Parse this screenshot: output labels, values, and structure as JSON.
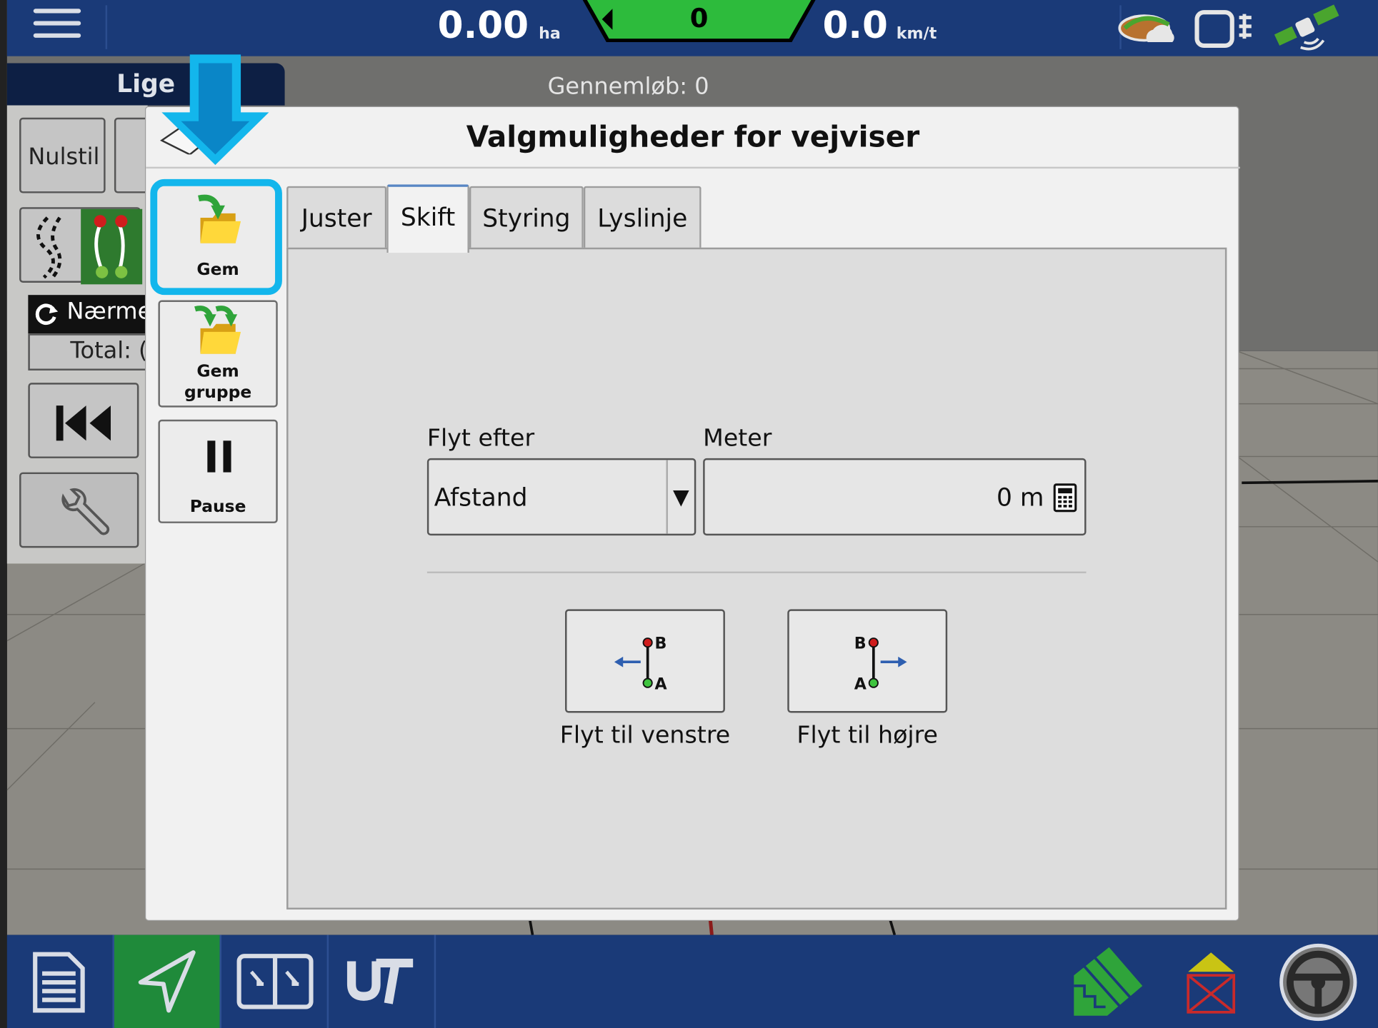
{
  "topbar": {
    "area_value": "0.00",
    "area_unit": "ha",
    "counter_value": "0",
    "speed_value": "0.0",
    "speed_unit": "km/t"
  },
  "guide_tab": {
    "label": "Lige"
  },
  "passes_label": "Gennemløb: 0",
  "background_panel": {
    "reset_label": "Nulstil",
    "nearest_label": "Nærme",
    "total_label": "Total: ("
  },
  "dialog": {
    "title": "Valgmuligheder for vejviser",
    "side_buttons": [
      {
        "label": "Gem"
      },
      {
        "label_line1": "Gem",
        "label_line2": "gruppe"
      },
      {
        "label": "Pause"
      }
    ],
    "tabs": [
      {
        "label": "Juster"
      },
      {
        "label": "Skift",
        "active": true
      },
      {
        "label": "Styring"
      },
      {
        "label": "Lyslinje"
      }
    ],
    "shift": {
      "move_by_label": "Flyt efter",
      "move_by_value": "Afstand",
      "meters_label": "Meter",
      "meters_value": "0 m",
      "move_left_label": "Flyt til venstre",
      "move_right_label": "Flyt til højre",
      "point_a": "A",
      "point_b": "B"
    }
  },
  "colors": {
    "topbar_bg": "#1a3a78",
    "counter_green": "#2dbb3c",
    "highlight_blue": "#13b6ec",
    "active_nav_green": "#1f8a3a"
  }
}
